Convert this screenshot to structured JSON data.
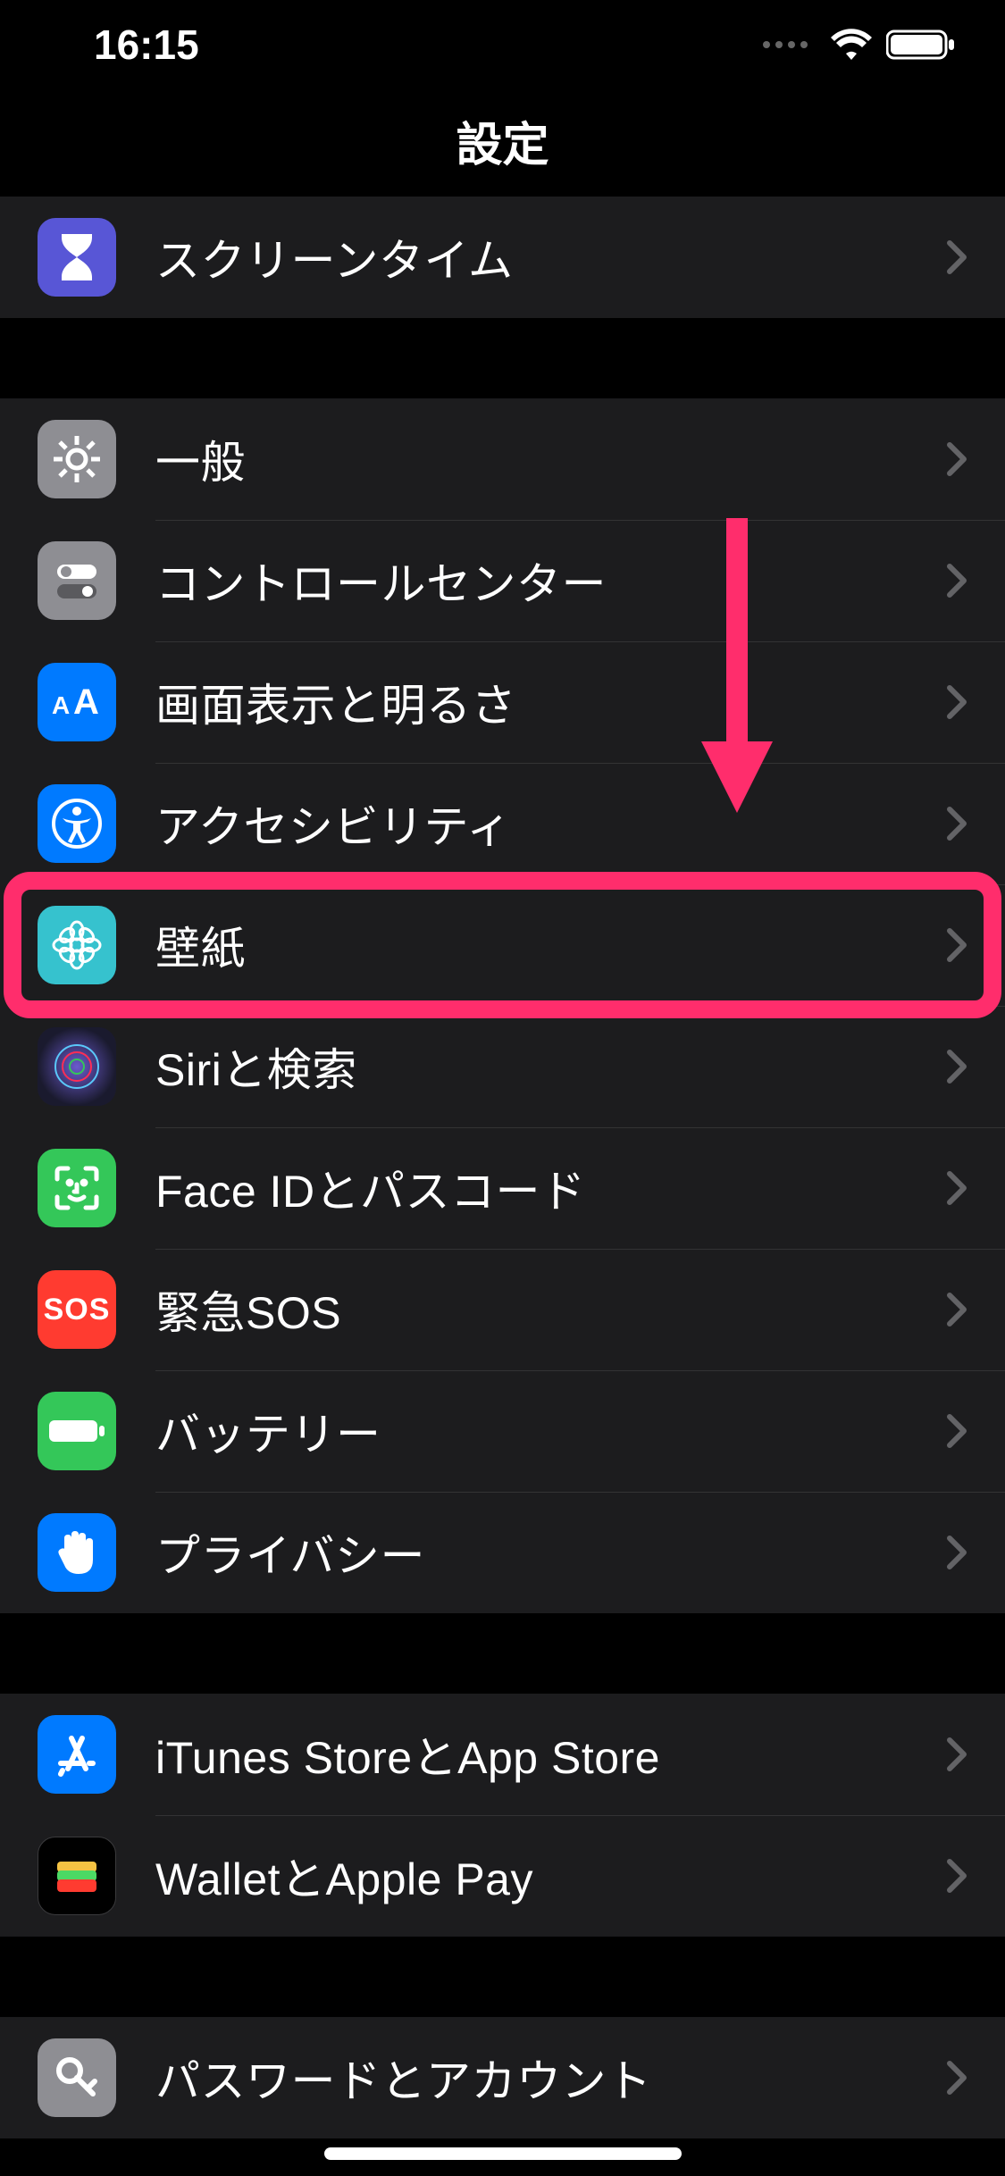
{
  "status": {
    "time": "16:15"
  },
  "header": {
    "title": "設定"
  },
  "annotation": {
    "highlight_target": "row-wallpaper",
    "highlight_color": "#ff2d6c",
    "arrow_color": "#ff2d6c"
  },
  "groups": [
    {
      "items": [
        {
          "id": "screen-time",
          "label": "スクリーンタイム",
          "icon": "hourglass-icon",
          "iconColor": "#5856d6"
        }
      ]
    },
    {
      "items": [
        {
          "id": "general",
          "label": "一般",
          "icon": "gear-icon",
          "iconColor": "#8e8e93"
        },
        {
          "id": "control-center",
          "label": "コントロールセンター",
          "icon": "toggles-icon",
          "iconColor": "#8e8e93"
        },
        {
          "id": "display-brightness",
          "label": "画面表示と明るさ",
          "icon": "text-size-icon",
          "iconColor": "#007aff"
        },
        {
          "id": "accessibility",
          "label": "アクセシビリティ",
          "icon": "accessibility-icon",
          "iconColor": "#007aff"
        },
        {
          "id": "wallpaper",
          "label": "壁紙",
          "icon": "flower-icon",
          "iconColor": "#36c2ce",
          "highlighted": true
        },
        {
          "id": "siri-search",
          "label": "Siriと検索",
          "icon": "siri-icon",
          "iconColor": "#1a1a2e"
        },
        {
          "id": "face-id-passcode",
          "label": "Face IDとパスコード",
          "icon": "face-id-icon",
          "iconColor": "#34c759"
        },
        {
          "id": "emergency-sos",
          "label": "緊急SOS",
          "icon": "sos-icon",
          "iconText": "SOS",
          "iconColor": "#ff3b30"
        },
        {
          "id": "battery",
          "label": "バッテリー",
          "icon": "battery-full-icon",
          "iconColor": "#34c759"
        },
        {
          "id": "privacy",
          "label": "プライバシー",
          "icon": "hand-icon",
          "iconColor": "#007aff"
        }
      ]
    },
    {
      "items": [
        {
          "id": "itunes-appstore",
          "label": "iTunes StoreとApp Store",
          "icon": "appstore-icon",
          "iconColor": "#007aff"
        },
        {
          "id": "wallet-applepay",
          "label": "WalletとApple Pay",
          "icon": "wallet-icon",
          "iconColor": "#000000"
        }
      ]
    },
    {
      "items": [
        {
          "id": "passwords-accounts",
          "label": "パスワードとアカウント",
          "icon": "key-icon",
          "iconColor": "#8e8e93"
        }
      ]
    }
  ]
}
